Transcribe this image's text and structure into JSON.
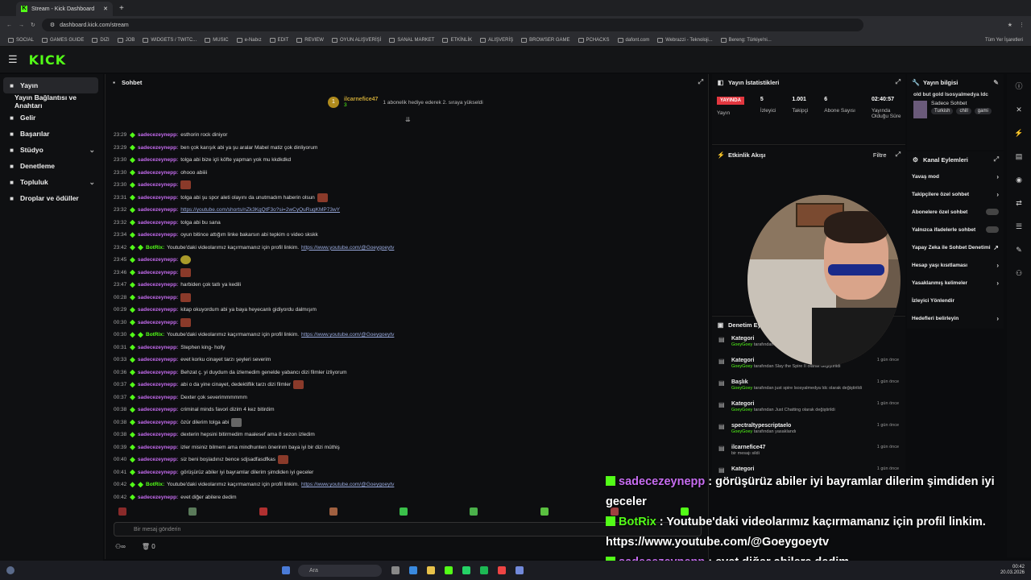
{
  "browser": {
    "tab_title": "Stream - Kick Dashboard",
    "url": "dashboard.kick.com/stream",
    "bookmarks": [
      "SOCIAL",
      "GAMES GUIDE",
      "DIZI",
      "JOB",
      "WIDGETS / TWITC...",
      "MUSIC",
      "e-Nabız",
      "EDIT",
      "REVIEW",
      "OYUN ALIŞVERİŞİ",
      "SANAL MARKET",
      "ETKİNLİK",
      "ALIŞVERİŞ",
      "BROWSER GAME",
      "PCHACKS",
      "dafont.com",
      "Webrazzi - Teknoloji...",
      "Bereng: Türkiye'ni..."
    ],
    "all_bookmarks": "Tüm Yer İşaretleri"
  },
  "app": {
    "logo": "KICK"
  },
  "sidebar": {
    "items": [
      {
        "label": "Yayın",
        "icon": "video-icon",
        "active": true
      },
      {
        "label": "Yayın Bağlantısı ve Anahtarı",
        "icon": "",
        "active": false
      },
      {
        "label": "Gelir",
        "icon": "money-icon",
        "active": false
      },
      {
        "label": "Başarılar",
        "icon": "trophy-icon",
        "active": false
      },
      {
        "label": "Stüdyo",
        "icon": "studio-icon",
        "active": false,
        "chevron": true
      },
      {
        "label": "Denetleme",
        "icon": "wrench-icon",
        "active": false
      },
      {
        "label": "Topluluk",
        "icon": "people-icon",
        "active": false,
        "chevron": true
      },
      {
        "label": "Droplar ve ödüller",
        "icon": "gift-icon",
        "active": false
      }
    ]
  },
  "chat": {
    "title": "Sohbet",
    "gift_user": "ilcarnefice47",
    "gift_count": "3",
    "gift_text": "1 abonelik hediye ederek 2. sıraya yükseldi",
    "messages": [
      {
        "t": "23:29",
        "u": "sadecezeynepp",
        "m": "esthorin rock diniyor"
      },
      {
        "t": "23:29",
        "u": "sadecezeynepp",
        "m": "ben çok karışık abi ya şu aralar Mabel matiz çok dinliyorum"
      },
      {
        "t": "23:30",
        "u": "sadecezeynepp",
        "m": "tolga abi bize içli köfte yapman yok mu kkdkdkd"
      },
      {
        "t": "23:30",
        "u": "sadecezeynepp",
        "m": "ohooo abiiii"
      },
      {
        "t": "23:30",
        "u": "sadecezeynepp",
        "m": "",
        "emote": "r"
      },
      {
        "t": "23:31",
        "u": "sadecezeynepp",
        "m": "tolga abi şu spor aleti olayını da unutmadım haberin olsun",
        "emote": "r"
      },
      {
        "t": "23:32",
        "u": "sadecezeynepp",
        "m": "",
        "link": "https://youtube.com/shorts/nZk3KgQtF3o?si=2wCyQuRugKMP73wY"
      },
      {
        "t": "23:32",
        "u": "sadecezeynepp",
        "m": "tolga abi bu sana"
      },
      {
        "t": "23:34",
        "u": "sadecezeynepp",
        "m": "oyun bitince attığım linke bakarsın abi tepkim o video skskk"
      },
      {
        "t": "23:42",
        "u": "BotRix",
        "bot": true,
        "m": "Youtube'daki videolarımız kaçırmamanız için profil linkim.",
        "link": "https://www.youtube.com/@Goeygoeytv"
      },
      {
        "t": "23:45",
        "u": "sadecezeynepp",
        "m": "",
        "emote": "g"
      },
      {
        "t": "23:46",
        "u": "sadecezeynepp",
        "m": "",
        "emote": "r"
      },
      {
        "t": "23:47",
        "u": "sadecezeynepp",
        "m": "harbiden çok tatlı ya kedili"
      },
      {
        "t": "00:28",
        "u": "sadecezeynepp",
        "m": "",
        "emote": "r"
      },
      {
        "t": "00:29",
        "u": "sadecezeynepp",
        "m": "kitap okuyordum abi ya baya heyecanlı gidiyordu dalmışım"
      },
      {
        "t": "00:30",
        "u": "sadecezeynepp",
        "m": "",
        "emote": "r"
      },
      {
        "t": "00:30",
        "u": "BotRix",
        "bot": true,
        "m": "Youtube'daki videolarımız kaçırmamanız için profil linkim.",
        "link": "https://www.youtube.com/@Goeygoeytv"
      },
      {
        "t": "00:31",
        "u": "sadecezeynepp",
        "m": "Stephen king- holly"
      },
      {
        "t": "00:33",
        "u": "sadecezeynepp",
        "m": "evet korku cinayet tarzı şeyleri severim"
      },
      {
        "t": "00:36",
        "u": "sadecezeynepp",
        "m": "Behzat ç. yi duydum da izlemedim genelde yabancı dizi filmler izliyorum"
      },
      {
        "t": "00:37",
        "u": "sadecezeynepp",
        "m": "abi o da yine cinayet, dedektiflik tarzı dizi filmler",
        "emote": "r"
      },
      {
        "t": "00:37",
        "u": "sadecezeynepp",
        "m": "Dexter çok severimmmmmm"
      },
      {
        "t": "00:38",
        "u": "sadecezeynepp",
        "m": "criminal minds favori dizim 4 kez bitirdim"
      },
      {
        "t": "00:38",
        "u": "sadecezeynepp",
        "m": "özür dilerim tolga abi",
        "emote": "b"
      },
      {
        "t": "00:38",
        "u": "sadecezeynepp",
        "m": "dexterin hepsini bitirmedim maalesef ama 8 sezon izledim"
      },
      {
        "t": "00:39",
        "u": "sadecezeynepp",
        "m": "izler misiniz bilmem ama mindhunten önerirım baya iyi bir dizi müthiş"
      },
      {
        "t": "00:40",
        "u": "sadecezeynepp",
        "m": "siz beni boşladınız bence sdjsadfasdfkas",
        "emote": "r"
      },
      {
        "t": "00:41",
        "u": "sadecezeynepp",
        "m": "görüşürüz abiler iyi bayramlar dilerim şimdiden iyi geceler"
      },
      {
        "t": "00:42",
        "u": "BotRix",
        "bot": true,
        "m": "Youtube'daki videolarımız kaçırmamanız için profil linkim.",
        "link": "https://www.youtube.com/@Goeygoeytv"
      },
      {
        "t": "00:42",
        "u": "sadecezeynepp",
        "m": "evet diğer abilere dedim"
      }
    ],
    "input_placeholder": "Bir mesaj gönderin",
    "footer_count": "0"
  },
  "stats": {
    "title": "Yayın İstatistikleri",
    "live": "YAYINDA",
    "live_sub": "Yayın",
    "items": [
      {
        "value": "5",
        "label": "İzleyici"
      },
      {
        "value": "1.001",
        "label": "Takipçi"
      },
      {
        "value": "6",
        "label": "Abone Sayısı"
      },
      {
        "value": "02:40:57",
        "label": "Yayında Olduğu Süre"
      }
    ]
  },
  "activity": {
    "title": "Etkinlik Akışı",
    "filter": "Filtre"
  },
  "modlog": {
    "title": "Denetim Ey",
    "items": [
      {
        "title": "Kategori",
        "by": "GoeyGoey",
        "rest": "tarafından",
        "when": ""
      },
      {
        "title": "Kategori",
        "by": "GoeyGoey",
        "rest": "tarafından Slay the Spire II olarak değiştirildi",
        "when": "1 gün önce"
      },
      {
        "title": "Başlık",
        "by": "GoeyGoey",
        "rest": "tarafından just spire lsosyalmedya ldc olarak değiştirildi",
        "when": "1 gün önce"
      },
      {
        "title": "Kategori",
        "by": "GoeyGoey",
        "rest": "tarafından Just Chatting olarak değiştirildi",
        "when": "1 gün önce"
      },
      {
        "title": "spectraltypescriptaelo",
        "by": "GoeyGoey",
        "rest": "tarafından yasaklandı",
        "when": "1 gün önce"
      },
      {
        "title": "ilcarnefice47",
        "by": "",
        "rest": "bir mesajı sildi",
        "when": "1 gün önce"
      },
      {
        "title": "Kategori",
        "by": "",
        "rest": "",
        "when": "1 gün önce"
      }
    ]
  },
  "info": {
    "title": "Yayın bilgisi",
    "stream_title": "old but gold lsosyalmedya ldc",
    "category": "Sadece Sohbet",
    "tags": [
      "Turkish",
      "chill",
      "gami"
    ]
  },
  "actions": {
    "title": "Kanal Eylemleri",
    "items": [
      {
        "label": "Yavaş mod",
        "type": "arrow"
      },
      {
        "label": "Takipçilere özel sohbet",
        "type": "arrow"
      },
      {
        "label": "Abonelere özel sohbet",
        "type": "toggle"
      },
      {
        "label": "Yalnızca ifadelerle sohbet",
        "type": "toggle"
      },
      {
        "label": "Yapay Zeka ile Sohbet Denetimi",
        "type": "ext"
      },
      {
        "label": "Hesap yaşı kısıtlaması",
        "type": "arrow"
      },
      {
        "label": "Yasaklanmış kelimeler",
        "type": "arrow"
      },
      {
        "label": "İzleyici Yönlendir",
        "type": "none"
      },
      {
        "label": "Hedefleri belirleyin",
        "type": "arrow"
      }
    ]
  },
  "overlay": [
    {
      "u": "sadecezeynepp",
      "m": " : görüşürüz abiler iyi bayramlar dilerim şimdiden iyi geceler",
      "bot": false
    },
    {
      "u": "BotRix",
      "m": " : Youtube'daki videolarımız kaçırmamanız için profil linkim. https://www.youtube.com/@Goeygoeytv",
      "bot": true
    },
    {
      "u": "sadecezeynepp",
      "m": " : evet diğer abilere dedim",
      "bot": false
    }
  ],
  "taskbar": {
    "search": "Ara",
    "time": "00:42",
    "date": "20.03.2026"
  },
  "colors": {
    "brand": "#53fc18",
    "username": "#c66cf0",
    "live": "#e2373f"
  }
}
